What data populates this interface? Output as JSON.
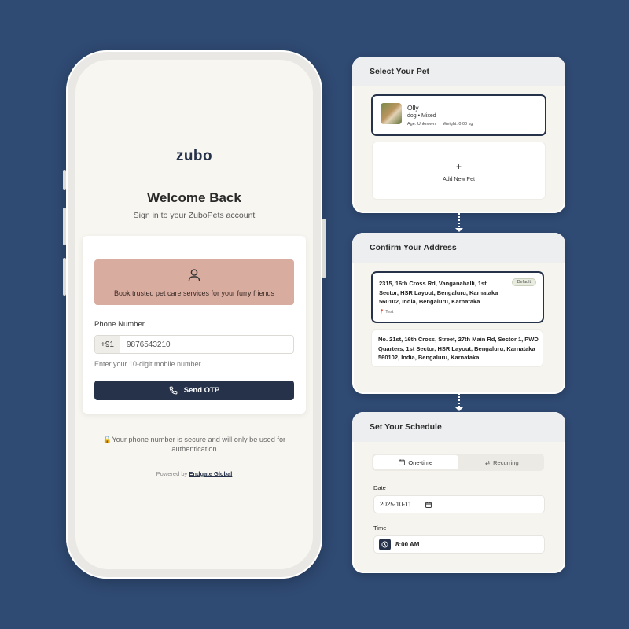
{
  "login": {
    "logo": "zubo",
    "title": "Welcome Back",
    "subtitle": "Sign in to your ZuboPets account",
    "banner_text": "Book trusted pet care services for your furry friends",
    "phone_label": "Phone Number",
    "country_code": "+91",
    "phone_value": "9876543210",
    "hint": "Enter your 10-digit mobile number",
    "send_button": "Send OTP",
    "secure_note": "🔒Your phone number is secure and will only be used for authentication",
    "powered_prefix": "Powered by",
    "powered_link": "Endgate Global"
  },
  "select_pet": {
    "title": "Select Your Pet",
    "pet": {
      "name": "Olly",
      "breed": "dog • Mixed",
      "age": "Age: Unknown",
      "weight": "Weight: 0.00 kg"
    },
    "add_plus": "+",
    "add_label": "Add New Pet"
  },
  "address": {
    "title": "Confirm Your Address",
    "addresses": [
      {
        "text": "2315, 16th Cross Rd, Vanganahalli, 1st Sector, HSR Layout, Bengaluru, Karnataka 560102, India, Bengaluru, Karnataka",
        "badge": "Default",
        "tag": "Test"
      },
      {
        "text": "No. 21st, 16th Cross, Street, 27th Main Rd, Sector 1, PWD Quarters, 1st Sector, HSR Layout, Bengaluru, Karnataka 560102, India, Bengaluru, Karnataka"
      }
    ]
  },
  "schedule": {
    "title": "Set Your Schedule",
    "tab_one_time": "One-time",
    "tab_recurring": "Recurring",
    "date_label": "Date",
    "date_value": "2025-10-11",
    "time_label": "Time",
    "time_value": "8:00 AM"
  },
  "icons": {
    "user": "user-icon",
    "phone": "phone-icon",
    "lock": "lock-icon",
    "calendar": "calendar-icon",
    "repeat": "repeat-icon",
    "clock": "clock-icon",
    "pin": "pin-icon"
  },
  "colors": {
    "background": "#2f4a73",
    "primary": "#26324a",
    "banner": "#d9aca0",
    "screen": "#f8f6f0"
  }
}
